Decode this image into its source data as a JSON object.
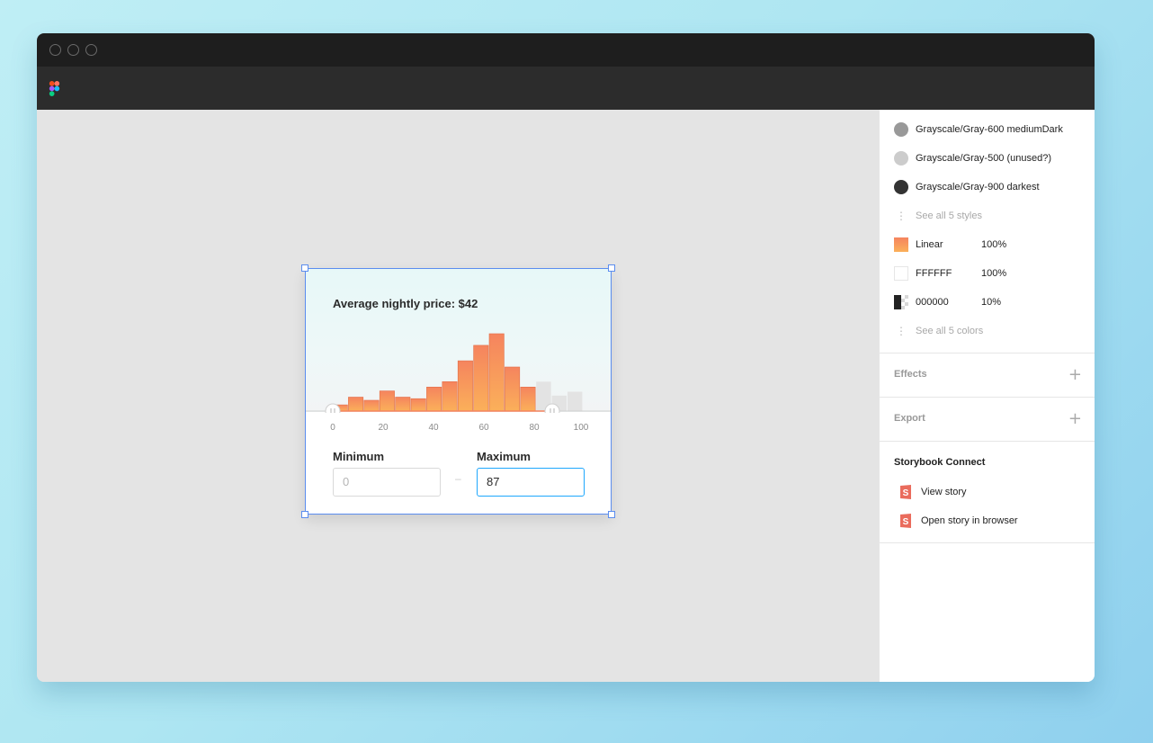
{
  "app": {
    "toolbar_logo": "figma-logo-icon"
  },
  "frame": {
    "title": "Average nightly price: $42",
    "histogram": {
      "bar_heights_pct": [
        8,
        18,
        14,
        26,
        18,
        16,
        31,
        38,
        65,
        85,
        100,
        57,
        31,
        38,
        20,
        25
      ],
      "selected_until_index": 13,
      "accent_top": "#f5845e",
      "accent_bottom": "#fbb05a",
      "inactive_color": "#e3e3e3"
    },
    "tick_labels": [
      "0",
      "20",
      "40",
      "60",
      "80",
      "100"
    ],
    "minimum_label": "Minimum",
    "maximum_label": "Maximum",
    "minimum_value": "0",
    "maximum_value": "87",
    "range_separator": "–"
  },
  "panel": {
    "color_styles": [
      {
        "name": "Grayscale/Gray-600 mediumDark",
        "color": "#999999"
      },
      {
        "name": "Grayscale/Gray-500 (unused?)",
        "color": "#cccccc"
      },
      {
        "name": "Grayscale/Gray-900 darkest",
        "color": "#333333"
      }
    ],
    "see_all_styles": "See all 5 styles",
    "fills": [
      {
        "name": "Linear",
        "opacity": "100%"
      },
      {
        "name": "FFFFFF",
        "opacity": "100%"
      },
      {
        "name": "000000",
        "opacity": "10%"
      }
    ],
    "see_all_colors": "See all 5 colors",
    "effects_label": "Effects",
    "export_label": "Export",
    "plus_symbol": "+",
    "storybook": {
      "title": "Storybook Connect",
      "items": [
        "View story",
        "Open story in browser"
      ],
      "icon_color": "#ea6c5d"
    }
  }
}
